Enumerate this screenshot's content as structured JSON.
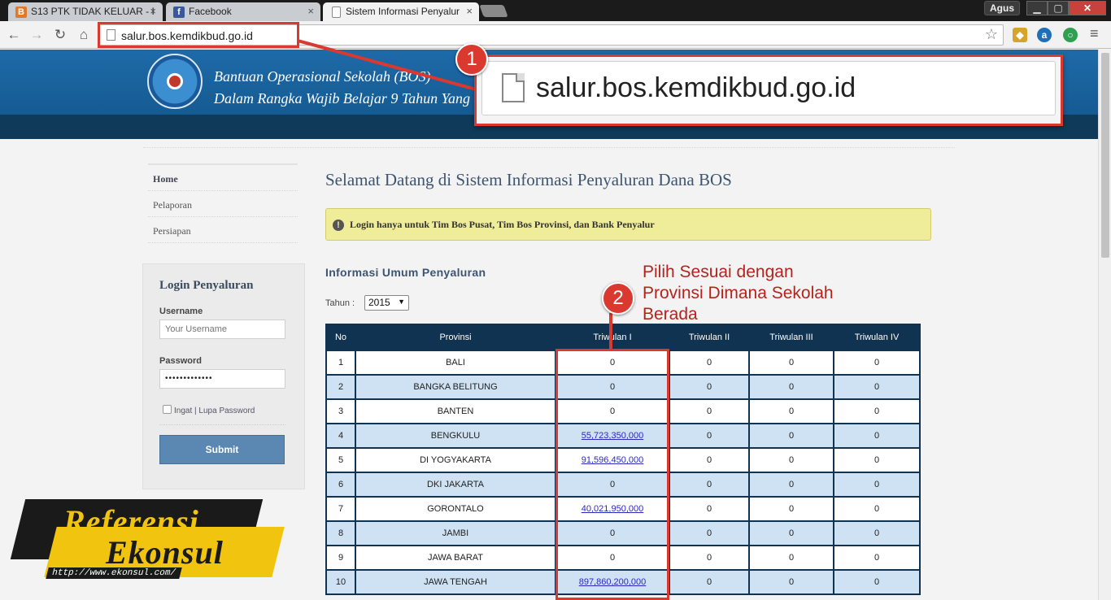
{
  "browser": {
    "tabs": [
      {
        "title": "S13 PTK TIDAK KELUAR - I",
        "icon": "blogger-icon"
      },
      {
        "title": "Facebook",
        "icon": "facebook-icon"
      },
      {
        "title": "Sistem Informasi Penyalur",
        "icon": "page-icon"
      }
    ],
    "user": "Agus",
    "url": "salur.bos.kemdikbud.go.id"
  },
  "header": {
    "line1": "Bantuan Operasional Sekolah (BOS)",
    "line2": "Dalam Rangka Wajib Belajar 9 Tahun Yang"
  },
  "nav": {
    "items": [
      "Home",
      "Pelaporan",
      "Persiapan"
    ]
  },
  "login": {
    "title": "Login Penyaluran",
    "username_label": "Username",
    "username_placeholder": "Your Username",
    "password_label": "Password",
    "password_value": "•••••••••••••",
    "remember_label": "Ingat",
    "forgot_label": "Lupa Password",
    "submit_label": "Submit"
  },
  "main": {
    "title": "Selamat Datang di Sistem Informasi Penyaluran Dana BOS",
    "alert": "Login hanya untuk Tim Bos Pusat, Tim Bos Provinsi, dan Bank Penyalur",
    "section_title": "Informasi Umum Penyaluran",
    "year_label": "Tahun :",
    "year_value": "2015"
  },
  "table": {
    "headers": [
      "No",
      "Provinsi",
      "Triwulan I",
      "Triwulan II",
      "Triwulan III",
      "Triwulan IV"
    ],
    "rows": [
      {
        "no": "1",
        "prov": "BALI",
        "t1": "0",
        "t2": "0",
        "t3": "0",
        "t4": "0"
      },
      {
        "no": "2",
        "prov": "BANGKA BELITUNG",
        "t1": "0",
        "t2": "0",
        "t3": "0",
        "t4": "0"
      },
      {
        "no": "3",
        "prov": "BANTEN",
        "t1": "0",
        "t2": "0",
        "t3": "0",
        "t4": "0"
      },
      {
        "no": "4",
        "prov": "BENGKULU",
        "t1": "55,723,350,000",
        "t2": "0",
        "t3": "0",
        "t4": "0"
      },
      {
        "no": "5",
        "prov": "DI YOGYAKARTA",
        "t1": "91,596,450,000",
        "t2": "0",
        "t3": "0",
        "t4": "0"
      },
      {
        "no": "6",
        "prov": "DKI JAKARTA",
        "t1": "0",
        "t2": "0",
        "t3": "0",
        "t4": "0"
      },
      {
        "no": "7",
        "prov": "GORONTALO",
        "t1": "40,021,950,000",
        "t2": "0",
        "t3": "0",
        "t4": "0"
      },
      {
        "no": "8",
        "prov": "JAMBI",
        "t1": "0",
        "t2": "0",
        "t3": "0",
        "t4": "0"
      },
      {
        "no": "9",
        "prov": "JAWA BARAT",
        "t1": "0",
        "t2": "0",
        "t3": "0",
        "t4": "0"
      },
      {
        "no": "10",
        "prov": "JAWA TENGAH",
        "t1": "897,860,200,000",
        "t2": "0",
        "t3": "0",
        "t4": "0"
      }
    ]
  },
  "annotations": {
    "badge1": "1",
    "badge2": "2",
    "zoom_url": "salur.bos.kemdikbud.go.id",
    "note": [
      "Pilih Sesuai dengan",
      "Provinsi Dimana Sekolah",
      "Berada"
    ],
    "accent_color": "#d9392f"
  },
  "watermark": {
    "line1": "Referensi",
    "line2": "Ekonsul",
    "url": "http://www.ekonsul.com/"
  }
}
